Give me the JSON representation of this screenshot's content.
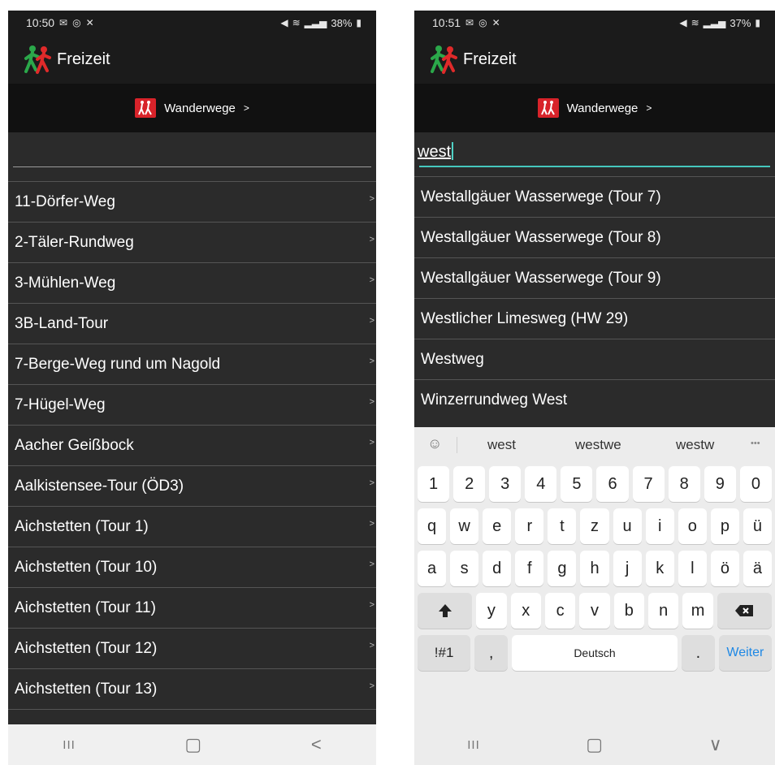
{
  "left_screen": {
    "status": {
      "time": "10:50",
      "battery": "38%"
    },
    "app_title": "Freizeit",
    "sub_header": "Wanderwege",
    "sub_chevron": ">",
    "search_value": "",
    "list": [
      "11-Dörfer-Weg",
      "2-Täler-Rundweg",
      "3-Mühlen-Weg",
      "3B-Land-Tour",
      "7-Berge-Weg rund um Nagold",
      "7-Hügel-Weg",
      "Aacher Geißbock",
      "Aalkistensee-Tour (ÖD3)",
      "Aichstetten (Tour 1)",
      "Aichstetten (Tour 10)",
      "Aichstetten (Tour 11)",
      "Aichstetten (Tour 12)",
      "Aichstetten (Tour 13)"
    ],
    "row_chevron": ">",
    "nav": {
      "recents": "III",
      "home": "▢",
      "back": "<"
    }
  },
  "right_screen": {
    "status": {
      "time": "10:51",
      "battery": "37%"
    },
    "app_title": "Freizeit",
    "sub_header": "Wanderwege",
    "sub_chevron": ">",
    "search_value": "west",
    "results": [
      "Westallgäuer Wasserwege (Tour 7)",
      "Westallgäuer Wasserwege (Tour 8)",
      "Westallgäuer Wasserwege (Tour 9)",
      "Westlicher Limesweg (HW 29)",
      "Westweg",
      "Winzerrundweg West"
    ],
    "keyboard": {
      "suggestions": [
        "west",
        "westwe",
        "westw"
      ],
      "more": "•••",
      "row_numbers": [
        "1",
        "2",
        "3",
        "4",
        "5",
        "6",
        "7",
        "8",
        "9",
        "0"
      ],
      "row_1": [
        "q",
        "w",
        "e",
        "r",
        "t",
        "z",
        "u",
        "i",
        "o",
        "p",
        "ü"
      ],
      "row_2": [
        "a",
        "s",
        "d",
        "f",
        "g",
        "h",
        "j",
        "k",
        "l",
        "ö",
        "ä"
      ],
      "row_3": [
        "y",
        "x",
        "c",
        "v",
        "b",
        "n",
        "m"
      ],
      "symbols": "!#1",
      "comma": ",",
      "space": "Deutsch",
      "period": ".",
      "enter": "Weiter"
    },
    "nav": {
      "recents": "III",
      "home": "▢",
      "hide_keyboard": "∨"
    }
  },
  "colors": {
    "bar_dark": "#1b1b1b",
    "list_bg": "#2b2b2b",
    "accent_teal": "#45c7bd",
    "icon_red": "#d8232a",
    "enter_blue": "#1e88e5"
  }
}
